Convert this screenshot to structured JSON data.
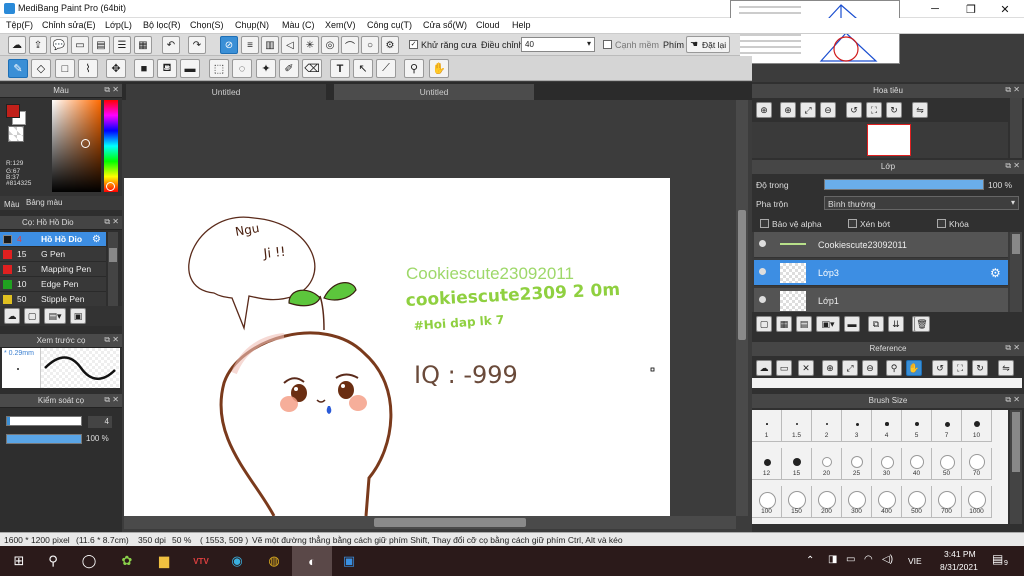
{
  "window": {
    "title": "MediBang Paint Pro (64bit)"
  },
  "menu": [
    "Tệp(F)",
    "Chỉnh sửa(E)",
    "Lớp(L)",
    "Bộ lọc(R)",
    "Chọn(S)",
    "Chụp(N)",
    "Màu (C)",
    "Xem(V)",
    "Công cụ(T)",
    "Cửa sổ(W)",
    "Cloud",
    "Help"
  ],
  "toolbar": {
    "antialias_label": "Khử răng cưa",
    "adjust_label": "Điều chỉnh",
    "adjust_value": "40",
    "snap_edge_label": "Cạnh mềm",
    "key_label": "Phím",
    "reset_label": "Đặt lại"
  },
  "color_panel": {
    "title": "Màu",
    "r": "R:129",
    "g": "G:67",
    "b": "B:37",
    "hex": "#814325",
    "main_color": "#814325",
    "tab_color": "Màu",
    "tab_palette": "Bảng màu"
  },
  "brush_panel": {
    "title": "Cọ: Hồ Hồ Dio",
    "items": [
      {
        "size": "4",
        "name": "Hồ Hồ Dio",
        "color": "#1a1a1a"
      },
      {
        "size": "15",
        "name": "G Pen",
        "color": "#e02020"
      },
      {
        "size": "15",
        "name": "Mapping Pen",
        "color": "#e02020"
      },
      {
        "size": "10",
        "name": "Edge Pen",
        "color": "#20a020"
      },
      {
        "size": "50",
        "name": "Stipple Pen",
        "color": "#e0c020"
      }
    ]
  },
  "preview_panel": {
    "title": "Xem trước cọ",
    "size_label": "* 0.29mm"
  },
  "control_panel": {
    "title": "Kiểm soát cọ",
    "size_value": "4",
    "opacity_value": "100 %"
  },
  "tabs": [
    "Untitled",
    "Untitled"
  ],
  "canvas_text": {
    "speech": "Ngu\nJi !!",
    "name1": "Cookiescute23092011",
    "name2": "cookiescute2309 2 0m",
    "name3": "#Hoi dap lk 7",
    "iq": "IQ : -999"
  },
  "navigator": {
    "title": "Hoa tiêu"
  },
  "layer_panel": {
    "title": "Lớp",
    "opacity_label": "Độ trong",
    "opacity_value": "100 %",
    "opacity_fraction": 1,
    "blend_label": "Pha trộn",
    "blend_value": "Bình thường",
    "protect_alpha": "Bảo vệ alpha",
    "clipping": "Xén bớt",
    "lock": "Khóa",
    "layers": [
      "Cookiescute23092011",
      "Lớp3",
      "Lớp1"
    ]
  },
  "reference_panel": {
    "title": "Reference"
  },
  "brush_size_panel": {
    "title": "Brush Size",
    "sizes": [
      "1",
      "1.5",
      "2",
      "3",
      "4",
      "5",
      "7",
      "10",
      "12",
      "15",
      "20",
      "25",
      "30",
      "40",
      "50",
      "70",
      "100",
      "150",
      "200",
      "300",
      "400",
      "500",
      "700",
      "1000"
    ]
  },
  "status": {
    "dimensions": "1600 * 1200 pixel",
    "physical": "(11.6 * 8.7cm)",
    "dpi": "350 dpi",
    "zoom": "50 %",
    "coords": "( 1553, 509 )",
    "hint": "Vẽ một đường thẳng bằng cách giữ phím Shift, Thay đổi cỡ cọ bằng cách giữ phím Ctrl, Alt và kéo"
  },
  "taskbar": {
    "lang": "VIE",
    "time": "3:41 PM",
    "date": "8/31/2021",
    "notifications": "9"
  }
}
